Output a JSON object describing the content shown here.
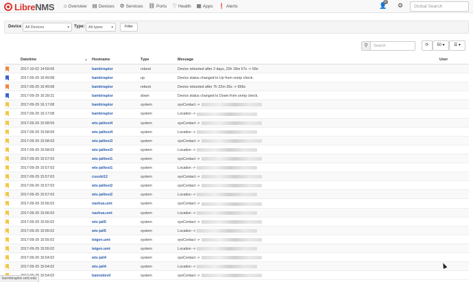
{
  "brand": {
    "name_lib": "Libre",
    "name_nms": "NMS"
  },
  "nav": [
    {
      "label": "Overview",
      "icon": "home-icon",
      "glyph": "⌂"
    },
    {
      "label": "Devices",
      "icon": "server-icon",
      "glyph": "▤"
    },
    {
      "label": "Services",
      "icon": "cogs-icon",
      "glyph": "⚙"
    },
    {
      "label": "Ports",
      "icon": "link-icon",
      "glyph": "⛓"
    },
    {
      "label": "Health",
      "icon": "heartbeat-icon",
      "glyph": "♡"
    },
    {
      "label": "Apps",
      "icon": "tasks-icon",
      "glyph": "▦"
    },
    {
      "label": "Alerts",
      "icon": "exclamation-icon",
      "glyph": "❗"
    }
  ],
  "user": {
    "badge": "0"
  },
  "global_search": {
    "placeholder": "Global Search"
  },
  "filter": {
    "device_label": "Device",
    "device_value": "All Devices",
    "type_label": "Type:",
    "type_value": "All types",
    "filter_button": "Filter"
  },
  "toolbar": {
    "search_placeholder": "Search",
    "refresh_glyph": "⟳",
    "page_size": "50 ▾",
    "columns_glyph": "☰ ▾"
  },
  "table": {
    "columns": [
      "Datetime",
      "Hostname",
      "Type",
      "Message",
      "User"
    ],
    "rows": [
      {
        "sev": "orange",
        "datetime": "2017-10-02 14:59:09",
        "host": "bambiraptor",
        "type": "reboot",
        "message": "Device rebooted after 2 days, 22h 18m 57s -> 59s",
        "redacted": false
      },
      {
        "sev": "blue",
        "datetime": "2017-09-29 16:49:08",
        "host": "bambiraptor",
        "type": "up",
        "message": "Device status changed to Up from snmp check.",
        "redacted": false
      },
      {
        "sev": "orange",
        "datetime": "2017-09-29 16:49:08",
        "host": "bambiraptor",
        "type": "reboot",
        "message": "Device rebooted after 7h 22m 35s -> 656s",
        "redacted": false
      },
      {
        "sev": "blue",
        "datetime": "2017-09-29 16:39:21",
        "host": "bambiraptor",
        "type": "down",
        "message": "Device status changed to Down from snmp check.",
        "redacted": false
      },
      {
        "sev": "yellow",
        "datetime": "2017-09-29 16:17:08",
        "host": "bambiraptor",
        "type": "system",
        "message": "sysContact ->",
        "redacted": true
      },
      {
        "sev": "yellow",
        "datetime": "2017-09-29 16:17:08",
        "host": "bambiraptor",
        "type": "system",
        "message": "Location ->",
        "redacted": true
      },
      {
        "sev": "yellow",
        "datetime": "2017-09-29 15:58:09",
        "host": "wts-jailtest4",
        "type": "system",
        "message": "sysContact ->",
        "redacted": true
      },
      {
        "sev": "yellow",
        "datetime": "2017-09-29 15:58:09",
        "host": "wts-jailtest4",
        "type": "system",
        "message": "Location ->",
        "redacted": true
      },
      {
        "sev": "yellow",
        "datetime": "2017-09-29 15:58:03",
        "host": "wts-jailtest3",
        "type": "system",
        "message": "sysContact ->",
        "redacted": true
      },
      {
        "sev": "yellow",
        "datetime": "2017-09-29 15:58:03",
        "host": "wts-jailtest3",
        "type": "system",
        "message": "Location ->",
        "redacted": true
      },
      {
        "sev": "yellow",
        "datetime": "2017-09-29 15:57:03",
        "host": "wts-jailtest1",
        "type": "system",
        "message": "sysContact ->",
        "redacted": true
      },
      {
        "sev": "yellow",
        "datetime": "2017-09-29 15:57:03",
        "host": "wts-jailtest1",
        "type": "system",
        "message": "Location ->",
        "redacted": true
      },
      {
        "sev": "yellow",
        "datetime": "2017-09-29 15:57:03",
        "host": "cussbt12",
        "type": "system",
        "message": "sysContact ->",
        "redacted": true
      },
      {
        "sev": "yellow",
        "datetime": "2017-09-29 15:57:03",
        "host": "wts-jailtest2",
        "type": "system",
        "message": "sysContact ->",
        "redacted": true
      },
      {
        "sev": "yellow",
        "datetime": "2017-09-29 15:57:03",
        "host": "wts-jailtest2",
        "type": "system",
        "message": "Location ->",
        "redacted": true
      },
      {
        "sev": "yellow",
        "datetime": "2017-09-29 15:56:03",
        "host": "nashua.umt",
        "type": "system",
        "message": "sysContact ->",
        "redacted": true
      },
      {
        "sev": "yellow",
        "datetime": "2017-09-29 15:56:03",
        "host": "nashua.umt",
        "type": "system",
        "message": "Location ->",
        "redacted": true
      },
      {
        "sev": "yellow",
        "datetime": "2017-09-29 15:55:02",
        "host": "wts-jail5",
        "type": "system",
        "message": "sysContact ->",
        "redacted": true
      },
      {
        "sev": "yellow",
        "datetime": "2017-09-29 15:55:02",
        "host": "wts-jail5",
        "type": "system",
        "message": "Location ->",
        "redacted": true
      },
      {
        "sev": "yellow",
        "datetime": "2017-09-29 15:55:02",
        "host": "teigen.umt",
        "type": "system",
        "message": "sysContact ->",
        "redacted": true
      },
      {
        "sev": "yellow",
        "datetime": "2017-09-29 15:55:02",
        "host": "teigen.umt",
        "type": "system",
        "message": "Location ->",
        "redacted": true
      },
      {
        "sev": "yellow",
        "datetime": "2017-09-29 15:54:02",
        "host": "wts-jail4",
        "type": "system",
        "message": "sysContact ->",
        "redacted": true
      },
      {
        "sev": "yellow",
        "datetime": "2017-09-29 15:54:02",
        "host": "wts-jail4",
        "type": "system",
        "message": "Location ->",
        "redacted": true
      },
      {
        "sev": "yellow",
        "datetime": "2017-09-29 15:54:02",
        "host": "bamsidevil",
        "type": "system",
        "message": "sysContact ->",
        "redacted": true
      }
    ]
  },
  "statusbar": {
    "url": "bambiraptor.umt.edu"
  },
  "colors": {
    "brand": "#d9322b",
    "link": "#2a5db0",
    "sev_orange": "#f0883e",
    "sev_blue": "#3b5fd1",
    "sev_yellow": "#f6c744"
  }
}
